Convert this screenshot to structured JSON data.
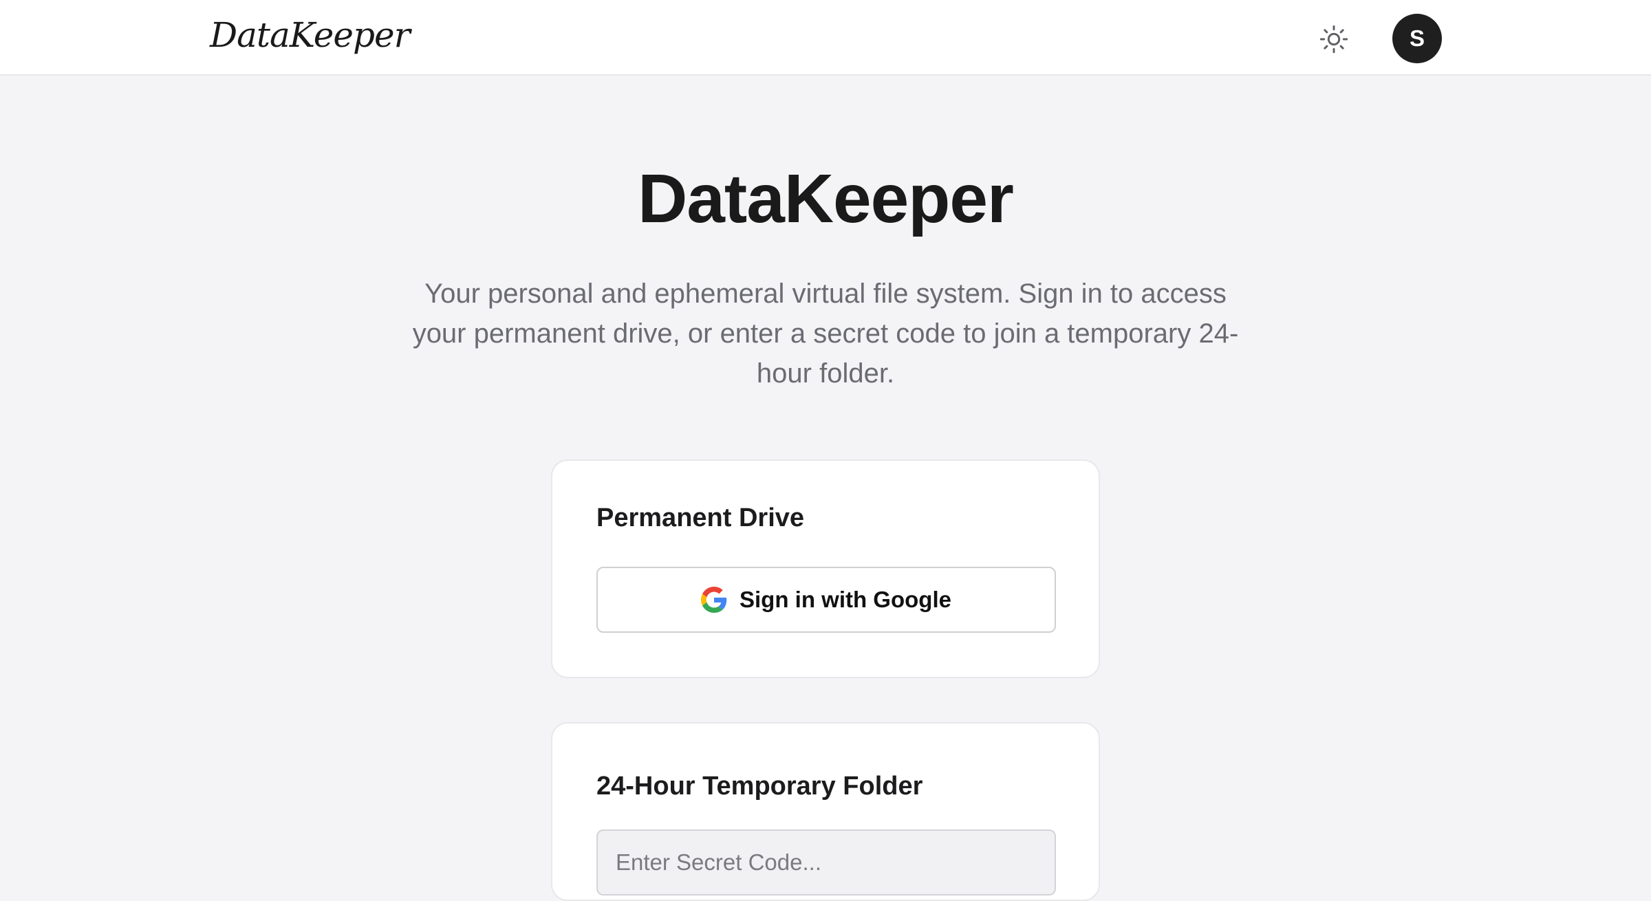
{
  "navbar": {
    "brand": "DataKeeper",
    "theme_toggle_icon": "sun-icon",
    "avatar_initial": "S"
  },
  "hero": {
    "title": "DataKeeper",
    "subtitle": "Your personal and ephemeral virtual file system. Sign in to access your permanent drive, or enter a secret code to join a temporary 24-hour folder."
  },
  "permanent_drive": {
    "title": "Permanent Drive",
    "google_button_label": "Sign in with Google",
    "google_icon": "google-icon"
  },
  "temporary_folder": {
    "title": "24-Hour Temporary Folder",
    "secret_code_placeholder": "Enter Secret Code...",
    "secret_code_value": ""
  },
  "colors": {
    "background": "#f4f4f6",
    "surface": "#ffffff",
    "text_primary": "#1c1c1e",
    "text_secondary": "#6b6b73",
    "avatar_bg": "#1f1f1f"
  }
}
